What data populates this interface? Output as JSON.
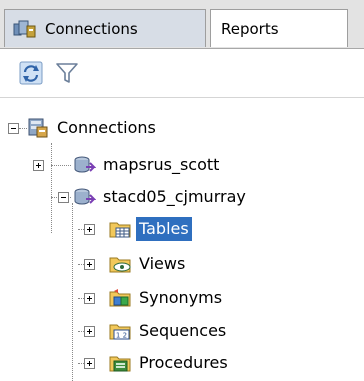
{
  "tabs": [
    {
      "label": "Connections",
      "icon": "connections-icon",
      "active": true
    },
    {
      "label": "Reports",
      "active": false
    }
  ],
  "toolbar": {
    "refresh_icon": "refresh-icon",
    "filter_icon": "filter-icon"
  },
  "tree": {
    "root": {
      "label": "Connections",
      "expanded": true,
      "icon": "database-icon"
    },
    "connections": [
      {
        "label": "mapsrus_scott",
        "expanded": false,
        "icon": "connection-icon"
      },
      {
        "label": "stacd05_cjmurray",
        "expanded": true,
        "icon": "connection-icon"
      }
    ],
    "children": [
      {
        "label": "Tables",
        "icon": "table-icon",
        "selected": true
      },
      {
        "label": "Views",
        "icon": "view-icon",
        "selected": false
      },
      {
        "label": "Synonyms",
        "icon": "synonym-icon",
        "selected": false
      },
      {
        "label": "Sequences",
        "icon": "sequence-icon",
        "selected": false
      },
      {
        "label": "Procedures",
        "icon": "procedure-icon",
        "selected": false
      }
    ]
  },
  "colors": {
    "selection": "#2f6fbf",
    "active_tab": "#d7dde6"
  }
}
